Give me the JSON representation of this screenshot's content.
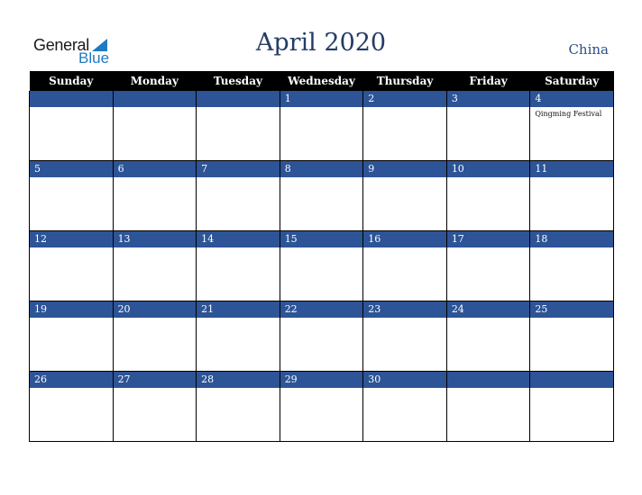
{
  "logo": {
    "general": "General",
    "blue": "Blue"
  },
  "title": "April 2020",
  "country": "China",
  "weekdays": [
    "Sunday",
    "Monday",
    "Tuesday",
    "Wednesday",
    "Thursday",
    "Friday",
    "Saturday"
  ],
  "weeks": [
    [
      {
        "day": "",
        "event": ""
      },
      {
        "day": "",
        "event": ""
      },
      {
        "day": "",
        "event": ""
      },
      {
        "day": "1",
        "event": ""
      },
      {
        "day": "2",
        "event": ""
      },
      {
        "day": "3",
        "event": ""
      },
      {
        "day": "4",
        "event": "Qingming Festival"
      }
    ],
    [
      {
        "day": "5",
        "event": ""
      },
      {
        "day": "6",
        "event": ""
      },
      {
        "day": "7",
        "event": ""
      },
      {
        "day": "8",
        "event": ""
      },
      {
        "day": "9",
        "event": ""
      },
      {
        "day": "10",
        "event": ""
      },
      {
        "day": "11",
        "event": ""
      }
    ],
    [
      {
        "day": "12",
        "event": ""
      },
      {
        "day": "13",
        "event": ""
      },
      {
        "day": "14",
        "event": ""
      },
      {
        "day": "15",
        "event": ""
      },
      {
        "day": "16",
        "event": ""
      },
      {
        "day": "17",
        "event": ""
      },
      {
        "day": "18",
        "event": ""
      }
    ],
    [
      {
        "day": "19",
        "event": ""
      },
      {
        "day": "20",
        "event": ""
      },
      {
        "day": "21",
        "event": ""
      },
      {
        "day": "22",
        "event": ""
      },
      {
        "day": "23",
        "event": ""
      },
      {
        "day": "24",
        "event": ""
      },
      {
        "day": "25",
        "event": ""
      }
    ],
    [
      {
        "day": "26",
        "event": ""
      },
      {
        "day": "27",
        "event": ""
      },
      {
        "day": "28",
        "event": ""
      },
      {
        "day": "29",
        "event": ""
      },
      {
        "day": "30",
        "event": ""
      },
      {
        "day": "",
        "event": ""
      },
      {
        "day": "",
        "event": ""
      }
    ]
  ],
  "colors": {
    "header_bg": "#000000",
    "day_bar": "#2d5496",
    "title": "#243c66",
    "logo_blue": "#1f7bc1"
  }
}
